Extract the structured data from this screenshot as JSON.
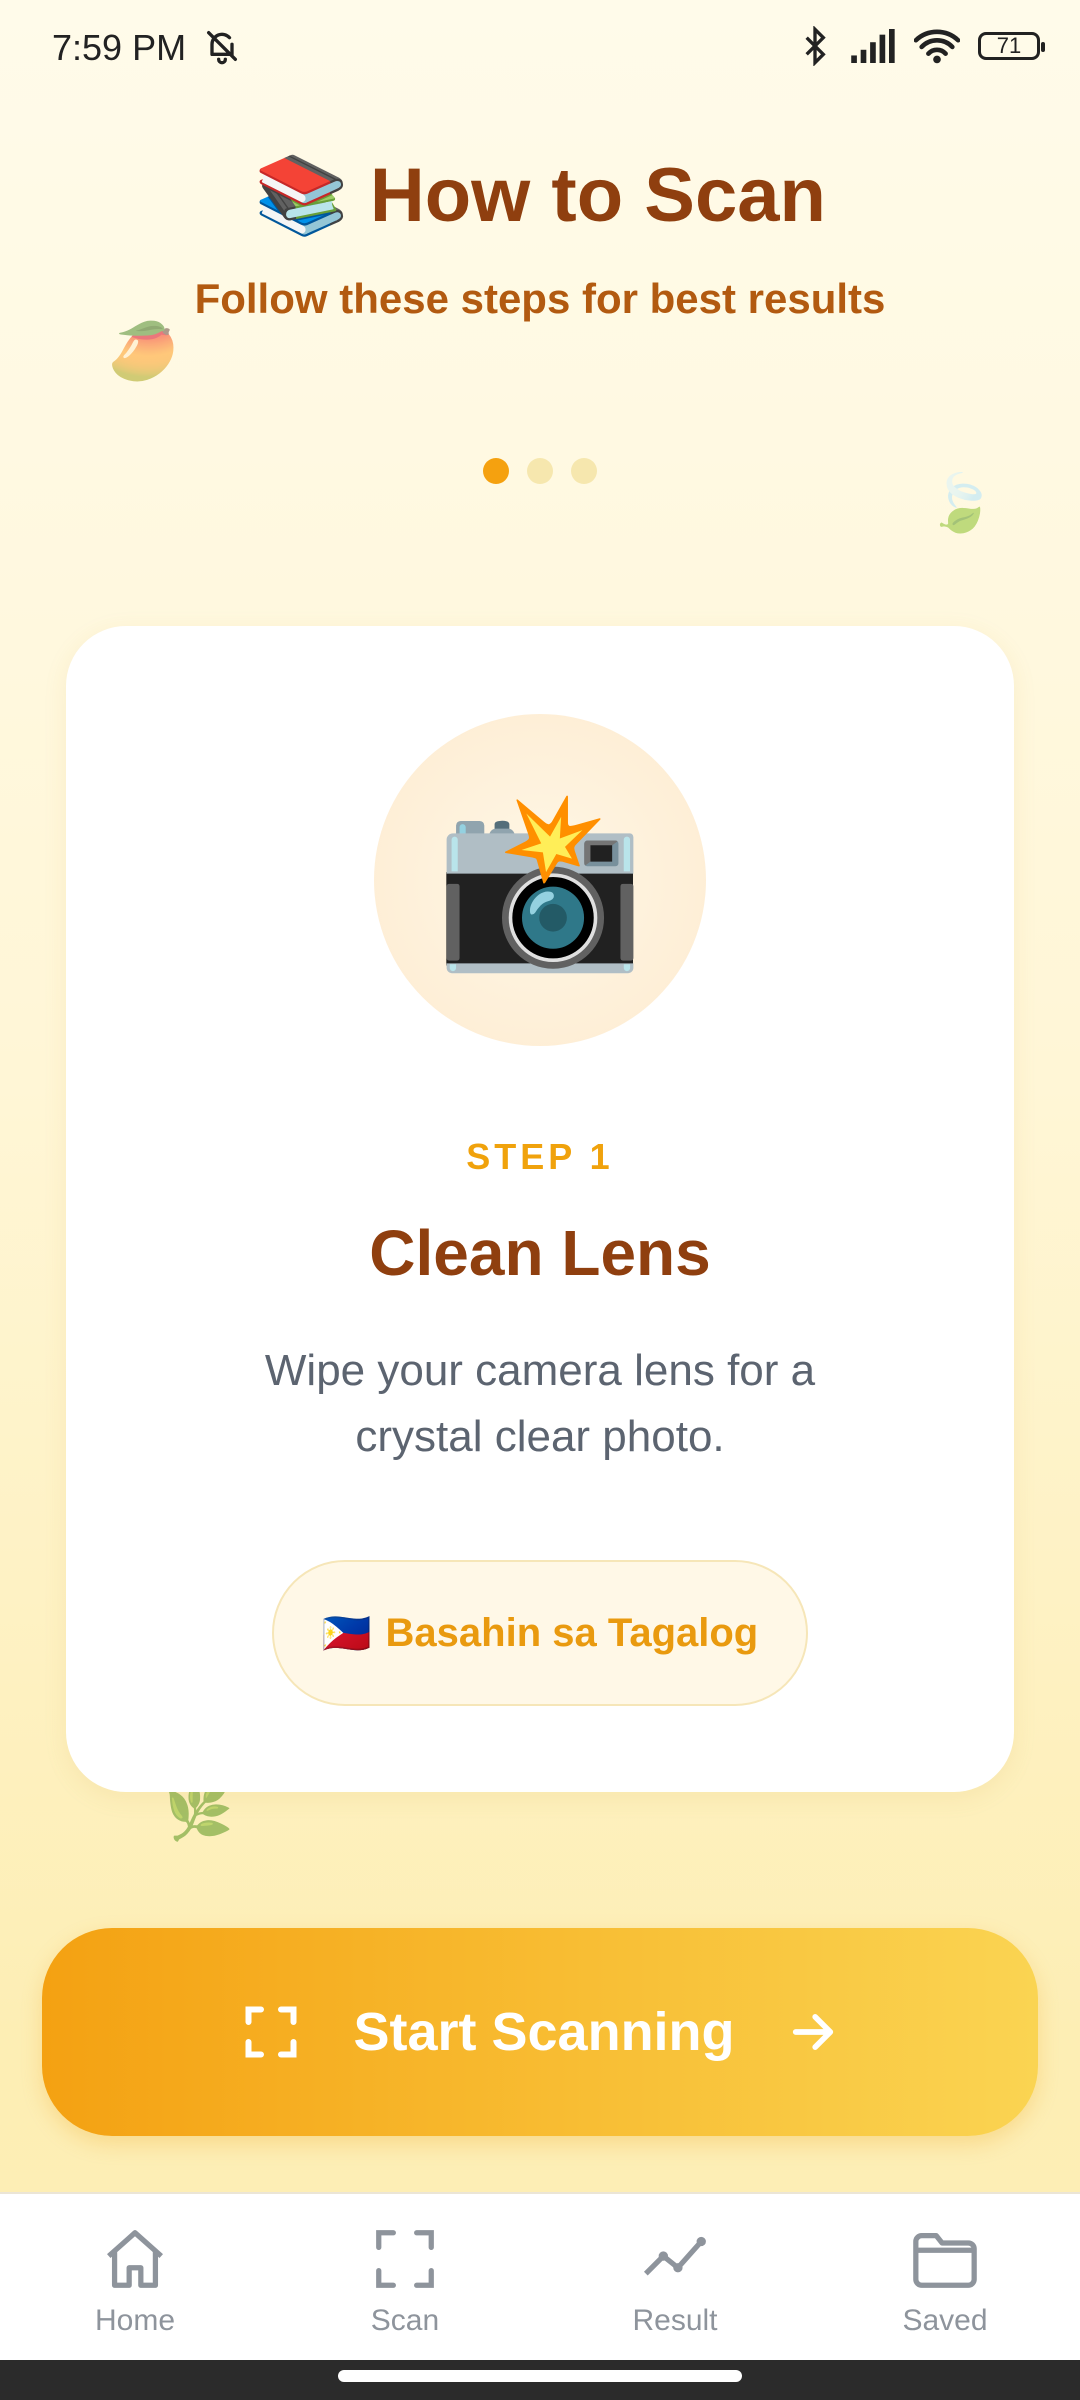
{
  "status_bar": {
    "time": "7:59 PM",
    "battery": "71",
    "icons": [
      "bell-off-icon",
      "bluetooth-icon",
      "signal-icon",
      "wifi-icon",
      "battery-icon"
    ]
  },
  "header": {
    "emoji": "📚",
    "title": "How to Scan",
    "subtitle": "Follow these steps for best results"
  },
  "pager": {
    "total": 3,
    "active": 1
  },
  "card": {
    "emoji": "📸",
    "step_label": "STEP 1",
    "title": "Clean Lens",
    "description": "Wipe your camera lens for a crystal clear photo.",
    "language_button": {
      "flag": "🇵🇭",
      "label": "Basahin sa Tagalog"
    }
  },
  "decorations": [
    "🥭",
    "🍃",
    "🌿"
  ],
  "start_button": {
    "label": "Start Scanning"
  },
  "bottom_nav": [
    {
      "label": "Home",
      "icon": "home-icon"
    },
    {
      "label": "Scan",
      "icon": "scan-icon"
    },
    {
      "label": "Result",
      "icon": "chart-line-icon"
    },
    {
      "label": "Saved",
      "icon": "folder-icon"
    }
  ],
  "colors": {
    "accent": "#f5a10f",
    "title_brown": "#8f3f0f",
    "subtitle_orange": "#b25a10",
    "nav_gray": "#8e949c"
  }
}
